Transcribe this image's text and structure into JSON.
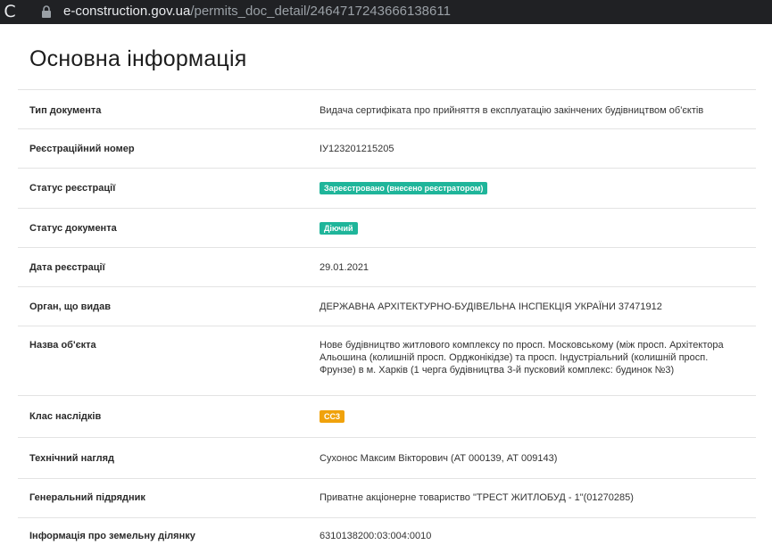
{
  "browser": {
    "reload_glyph": "C",
    "url_host": "e-construction.gov.ua",
    "url_path": "/permits_doc_detail/2464717243666138611",
    "icons": {
      "reload": "reload-icon",
      "lock": "lock-icon"
    }
  },
  "page": {
    "title": "Основна інформація"
  },
  "rows": [
    {
      "label": "Тип документа",
      "value": "Видача сертифіката про прийняття в експлуатацію закінчених будівництвом об'єктів"
    },
    {
      "label": "Реєстраційний номер",
      "value": "ІУ123201215205"
    },
    {
      "label": "Статус реєстрації",
      "badge": "Зареєстровано (внесено реєстратором)",
      "badge_color": "#1fb59a"
    },
    {
      "label": "Статус документа",
      "badge": "Діючий",
      "badge_color": "#1fb59a"
    },
    {
      "label": "Дата реєстрації",
      "value": "29.01.2021"
    },
    {
      "label": "Орган, що видав",
      "value": "ДЕРЖАВНА АРХІТЕКТУРНО-БУДІВЕЛЬНА ІНСПЕКЦІЯ УКРАЇНИ 37471912"
    },
    {
      "label": "Назва об'єкта",
      "value": "Нове будівництво житлового комплексу по просп. Московському (між просп. Архітектора Альошина (колишній просп. Орджонікідзе) та просп. Індустріальний (колишній просп. Фрунзе) в м. Харків (1 черга будівництва 3-й пусковий комплекс: будинок №3)"
    },
    {
      "label": "Клас наслідків",
      "badge": "СС3",
      "badge_color": "#f0a20c"
    },
    {
      "label": "Технічний нагляд",
      "value": "Сухонос Максим Вікторович (АТ 000139, АТ 009143)"
    },
    {
      "label": "Генеральний підрядник",
      "value": "Приватне акціонерне товариство \"ТРЕСТ ЖИТЛОБУД - 1\"(01270285)"
    },
    {
      "label": "Інформація про земельну ділянку",
      "value": "6310138200:03:004:0010"
    }
  ]
}
